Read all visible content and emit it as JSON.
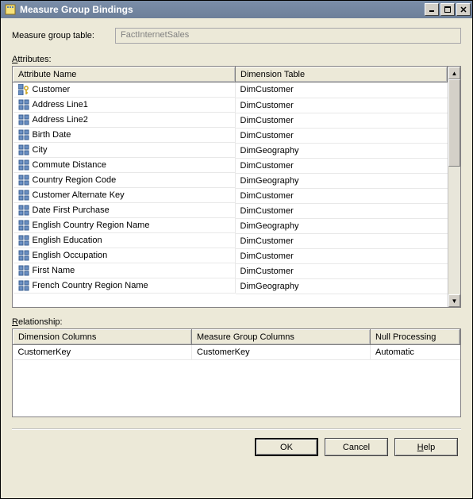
{
  "window": {
    "title": "Measure Group Bindings"
  },
  "labels": {
    "measureGroupTable": "Measure group table:",
    "attributes": "Attributes:",
    "relationship": "Relationship:"
  },
  "measureGroupTableValue": "FactInternetSales",
  "attributesHeaders": {
    "attrName": "Attribute Name",
    "dimTable": "Dimension Table"
  },
  "attributes": [
    {
      "name": "Customer",
      "dim": "DimCustomer",
      "key": true
    },
    {
      "name": "Address Line1",
      "dim": "DimCustomer",
      "key": false
    },
    {
      "name": "Address Line2",
      "dim": "DimCustomer",
      "key": false
    },
    {
      "name": "Birth Date",
      "dim": "DimCustomer",
      "key": false
    },
    {
      "name": "City",
      "dim": "DimGeography",
      "key": false
    },
    {
      "name": "Commute Distance",
      "dim": "DimCustomer",
      "key": false
    },
    {
      "name": "Country Region Code",
      "dim": "DimGeography",
      "key": false
    },
    {
      "name": "Customer Alternate Key",
      "dim": "DimCustomer",
      "key": false
    },
    {
      "name": "Date First Purchase",
      "dim": "DimCustomer",
      "key": false
    },
    {
      "name": "English Country Region Name",
      "dim": "DimGeography",
      "key": false
    },
    {
      "name": "English Education",
      "dim": "DimCustomer",
      "key": false
    },
    {
      "name": "English Occupation",
      "dim": "DimCustomer",
      "key": false
    },
    {
      "name": "First Name",
      "dim": "DimCustomer",
      "key": false
    },
    {
      "name": "French Country Region Name",
      "dim": "DimGeography",
      "key": false
    }
  ],
  "relationshipHeaders": {
    "dimCols": "Dimension Columns",
    "mgCols": "Measure Group Columns",
    "nullProc": "Null Processing"
  },
  "relationships": [
    {
      "dimCol": "CustomerKey",
      "mgCol": "CustomerKey",
      "nullProc": "Automatic"
    }
  ],
  "buttons": {
    "ok": "OK",
    "cancel": "Cancel",
    "help": "Help"
  }
}
